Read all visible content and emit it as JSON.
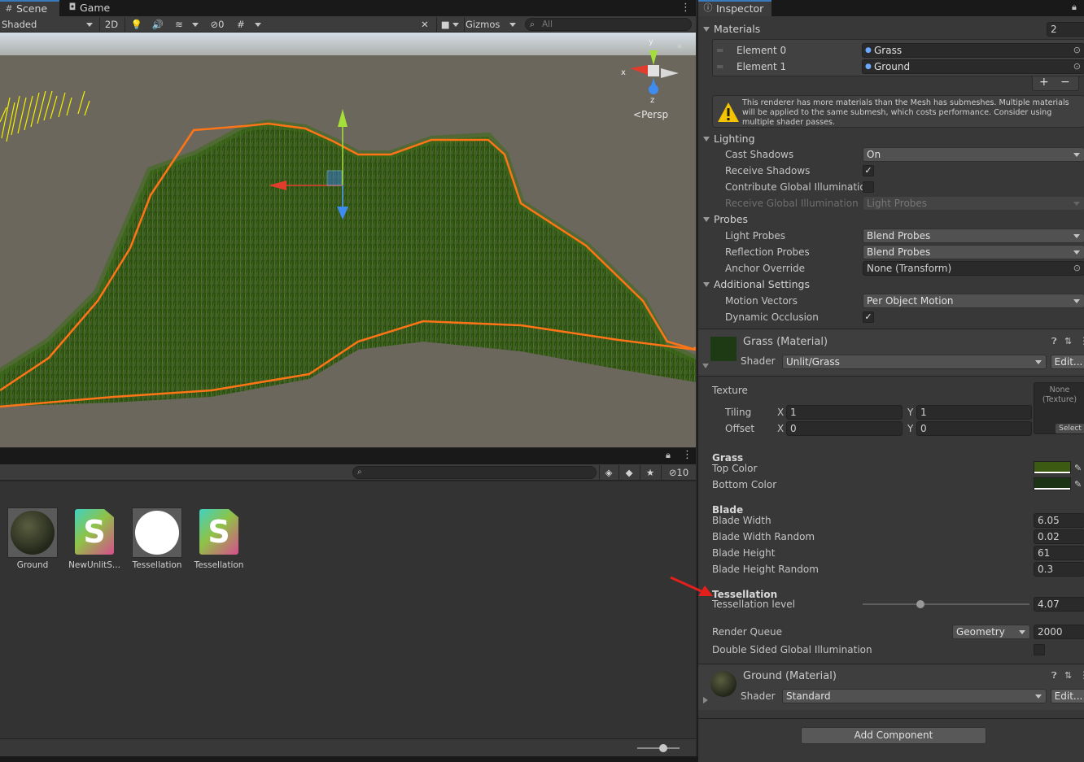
{
  "scene_tabs": [
    {
      "label": "Scene"
    },
    {
      "label": "Game"
    }
  ],
  "scene_toolbar": {
    "draw_mode": "Shaded",
    "mode_2d": "2D",
    "hidden_count": "0",
    "gizmos": "Gizmos",
    "search_placeholder": "All"
  },
  "gizmo": {
    "y": "y",
    "x": "x",
    "z": "z",
    "persp": "Persp"
  },
  "project": {
    "hidden_count": "10",
    "assets": [
      {
        "label": "Ground",
        "icon": "sphere-material"
      },
      {
        "label": "NewUnlitS...",
        "icon": "shader-s"
      },
      {
        "label": "Tessellation",
        "icon": "white-sphere"
      },
      {
        "label": "Tessellation",
        "icon": "shader-s"
      }
    ]
  },
  "inspector": {
    "tab_label": "Inspector",
    "materials": {
      "header": "Materials",
      "count": "2",
      "elements": [
        {
          "label": "Element 0",
          "value": "Grass"
        },
        {
          "label": "Element 1",
          "value": "Ground"
        }
      ],
      "plus": "+",
      "minus": "−",
      "warning": "This renderer has more materials than the Mesh has submeshes. Multiple materials will be applied to the same submesh, which costs performance. Consider using multiple shader passes."
    },
    "lighting": {
      "header": "Lighting",
      "cast_shadows": {
        "label": "Cast Shadows",
        "value": "On"
      },
      "receive_shadows": {
        "label": "Receive Shadows",
        "checked": "✓"
      },
      "contribute_gi": {
        "label": "Contribute Global Illumination"
      },
      "receive_gi": {
        "label": "Receive Global Illumination",
        "value": "Light Probes"
      }
    },
    "probes": {
      "header": "Probes",
      "light_probes": {
        "label": "Light Probes",
        "value": "Blend Probes"
      },
      "reflection_probes": {
        "label": "Reflection Probes",
        "value": "Blend Probes"
      },
      "anchor_override": {
        "label": "Anchor Override",
        "value": "None (Transform)"
      }
    },
    "additional": {
      "header": "Additional Settings",
      "motion_vectors": {
        "label": "Motion Vectors",
        "value": "Per Object Motion"
      },
      "dynamic_occlusion": {
        "label": "Dynamic Occlusion",
        "checked": "✓"
      }
    },
    "grass_material": {
      "title": "Grass (Material)",
      "shader_label": "Shader",
      "shader": "Unlit/Grass",
      "edit": "Edit...",
      "texture_label": "Texture",
      "texture_none": "None (Texture)",
      "texture_select": "Select",
      "tiling_label": "Tiling",
      "offset_label": "Offset",
      "x_label": "X",
      "y_label": "Y",
      "tiling_x": "1",
      "tiling_y": "1",
      "offset_x": "0",
      "offset_y": "0",
      "grass_header": "Grass",
      "top_color_label": "Top Color",
      "bottom_color_label": "Bottom Color",
      "top_color": "#3d5a12",
      "bottom_color": "#1b3415",
      "blade_header": "Blade",
      "blade_width": {
        "label": "Blade Width",
        "value": "6.05"
      },
      "blade_width_random": {
        "label": "Blade Width Random",
        "value": "0.02"
      },
      "blade_height": {
        "label": "Blade Height",
        "value": "61"
      },
      "blade_height_random": {
        "label": "Blade Height Random",
        "value": "0.3"
      },
      "tess_header": "Tessellation",
      "tess_level": {
        "label": "Tessellation level",
        "value": "4.07"
      },
      "render_queue": {
        "label": "Render Queue",
        "dropdown": "Geometry",
        "value": "2000"
      },
      "double_sided_gi": {
        "label": "Double Sided Global Illumination"
      }
    },
    "ground_material": {
      "title": "Ground (Material)",
      "shader_label": "Shader",
      "shader": "Standard",
      "edit": "Edit..."
    },
    "add_component": "Add Component"
  }
}
